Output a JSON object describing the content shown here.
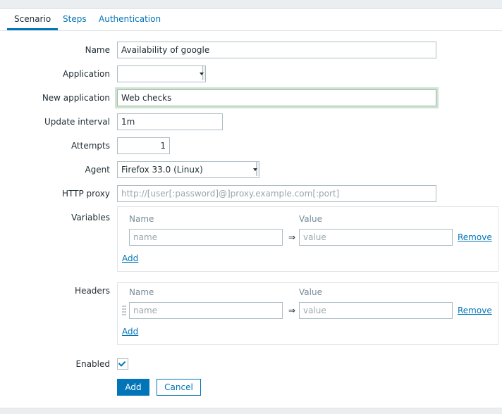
{
  "tabs": [
    {
      "label": "Scenario",
      "active": true
    },
    {
      "label": "Steps"
    },
    {
      "label": "Authentication"
    }
  ],
  "form": {
    "name": {
      "label": "Name",
      "value": "Availability of google"
    },
    "application": {
      "label": "Application",
      "value": ""
    },
    "new_application": {
      "label": "New application",
      "value": "Web checks"
    },
    "update_interval": {
      "label": "Update interval",
      "value": "1m"
    },
    "attempts": {
      "label": "Attempts",
      "value": "1"
    },
    "agent": {
      "label": "Agent",
      "value": "Firefox 33.0 (Linux)"
    },
    "http_proxy": {
      "label": "HTTP proxy",
      "placeholder": "http://[user[:password]@]proxy.example.com[:port]"
    },
    "variables": {
      "label": "Variables",
      "col_name": "Name",
      "col_value": "Value",
      "name_placeholder": "name",
      "value_placeholder": "value",
      "arrow": "⇒",
      "remove": "Remove",
      "add": "Add"
    },
    "headers": {
      "label": "Headers",
      "col_name": "Name",
      "col_value": "Value",
      "name_placeholder": "name",
      "value_placeholder": "value",
      "arrow": "⇒",
      "remove": "Remove",
      "add": "Add"
    },
    "enabled": {
      "label": "Enabled",
      "checked": true
    }
  },
  "buttons": {
    "add": "Add",
    "cancel": "Cancel"
  },
  "colors": {
    "accent": "#0275b8",
    "text": "#1f2c33",
    "muted": "#768d99",
    "page_bg": "#ebeef0"
  }
}
